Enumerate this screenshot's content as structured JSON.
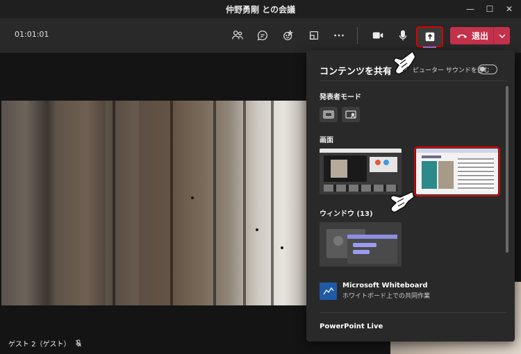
{
  "window": {
    "title": "仲野勇剛 との会議",
    "minimize": "—",
    "maximize": "☐",
    "close": "✕"
  },
  "toolbar": {
    "timer": "01:01:01",
    "leave_label": "退出",
    "leave_color": "#c4314b",
    "accent_color": "#7f85f5",
    "highlight_color": "#e00000"
  },
  "video": {
    "participant_label": "ゲスト 2（ゲスト）"
  },
  "share_panel": {
    "title": "コンテンツを共有",
    "computer_audio_label": "ピューター サウンドを含む",
    "presenter_mode_heading": "発表者モード",
    "screen_heading": "画面",
    "window_heading": "ウィンドウ (13)",
    "whiteboard_title": "Microsoft Whiteboard",
    "whiteboard_subtitle": "ホワイトボード上での共同作業",
    "powerpoint_heading": "PowerPoint Live"
  }
}
